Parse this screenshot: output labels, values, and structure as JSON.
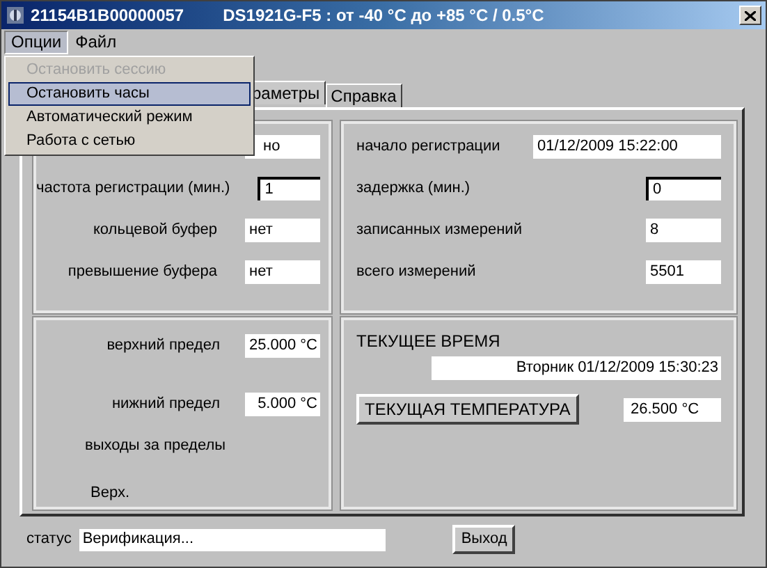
{
  "window": {
    "serial": "21154B1B00000057",
    "device": "DS1921G-F5 : от -40 °C до +85 °C / 0.5°C"
  },
  "menu": [
    {
      "label": "Опции",
      "selected": true
    },
    {
      "label": "Файл",
      "selected": false
    }
  ],
  "dropdown": [
    {
      "label": "Остановить сессию",
      "disabled": true,
      "selected": false
    },
    {
      "label": "Остановить часы",
      "disabled": false,
      "selected": true
    },
    {
      "label": "Автоматический режим",
      "disabled": false,
      "selected": false
    },
    {
      "label": "Работа с сетью",
      "disabled": false,
      "selected": false
    }
  ],
  "tabs": [
    {
      "label": "раметры",
      "selected": true
    },
    {
      "label": "Справка",
      "selected": false
    }
  ],
  "session": [
    {
      "value": "но",
      "kind": "covered"
    },
    {
      "label": "частота регистрации (мин.)",
      "value": "1",
      "kind": "edit"
    },
    {
      "label": "кольцевой буфер",
      "value": "нет",
      "kind": "display"
    },
    {
      "label": "превышение буфера",
      "value": "нет",
      "kind": "display"
    }
  ],
  "registration": [
    {
      "label": "начало регистрации",
      "value": "01/12/2009 15:22:00",
      "kind": "wide"
    },
    {
      "label": "задержка (мин.)",
      "value": "0",
      "kind": "edit"
    },
    {
      "label": "записанных измерений",
      "value": "8",
      "kind": "display"
    },
    {
      "label": "всего измерений",
      "value": "5501",
      "kind": "display"
    }
  ],
  "limits": {
    "rows": [
      {
        "label": "верхний предел",
        "value": "25.000 °C"
      },
      {
        "label": "нижний предел",
        "value": "5.000 °C"
      }
    ],
    "excursions": "выходы за пределы",
    "upper": "Верх."
  },
  "clock": {
    "heading": "ТЕКУЩЕЕ ВРЕМЯ",
    "time": "Вторник 01/12/2009 15:30:23",
    "button": "ТЕКУЩАЯ ТЕМПЕРАТУРА",
    "temperature": "26.500 °C"
  },
  "status": {
    "label": "статус",
    "value": "Верификация...",
    "button": "Выход"
  }
}
